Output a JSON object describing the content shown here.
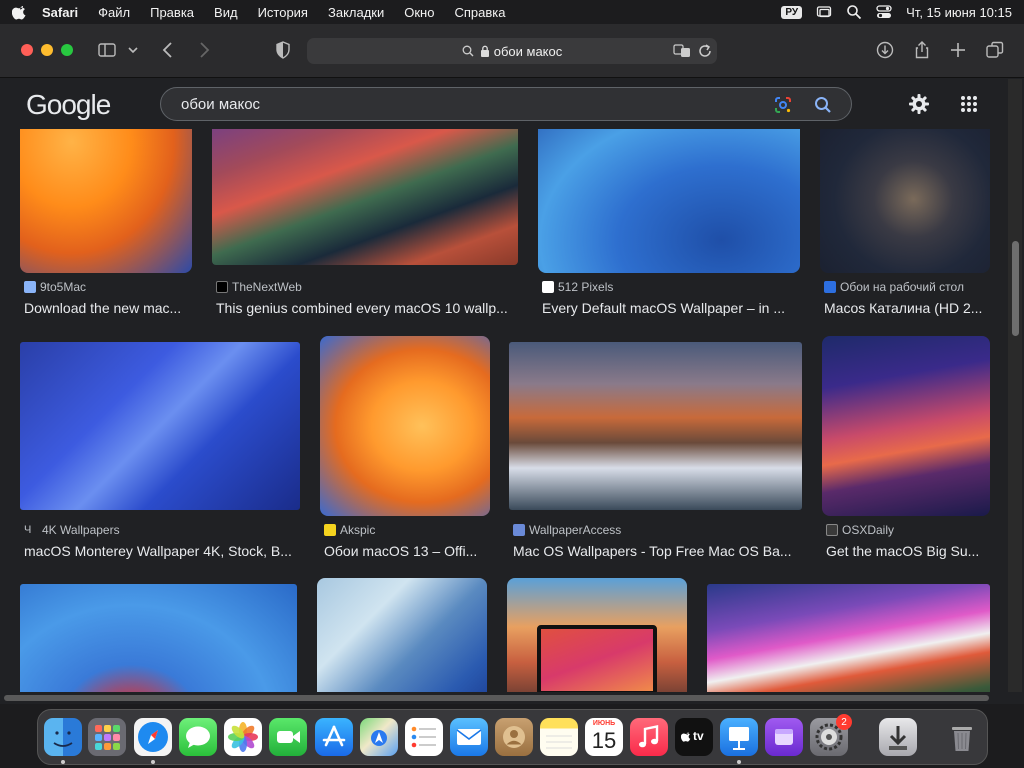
{
  "menubar": {
    "app": "Safari",
    "items": [
      "Файл",
      "Правка",
      "Вид",
      "История",
      "Закладки",
      "Окно",
      "Справка"
    ],
    "lang": "РУ",
    "datetime": "Чт, 15 июня  10:15"
  },
  "browser": {
    "url": "обои макос"
  },
  "google": {
    "logo": "Google",
    "query": "обои макос"
  },
  "results": [
    {
      "source": "9to5Mac",
      "title": "Download the new mac..."
    },
    {
      "source": "TheNextWeb",
      "title": "This genius combined every macOS 10 wallp..."
    },
    {
      "source": "512 Pixels",
      "title": "Every Default macOS Wallpaper – in ..."
    },
    {
      "source": "Обои на рабочий стол",
      "title": "Macos Каталина (HD 2..."
    },
    {
      "source": "4K Wallpapers",
      "title": "macOS Monterey Wallpaper 4K, Stock, B..."
    },
    {
      "source": "Akspic",
      "title": "Обои macOS 13 – Offi..."
    },
    {
      "source": "WallpaperAccess",
      "title": "Mac OS Wallpapers - Top Free Mac OS Ba..."
    },
    {
      "source": "OSXDaily",
      "title": "Get the macOS Big Su..."
    }
  ],
  "dock": {
    "calendar_month": "ИЮНЬ",
    "calendar_day": "15",
    "tv_label": "tv",
    "settings_badge": "2"
  }
}
